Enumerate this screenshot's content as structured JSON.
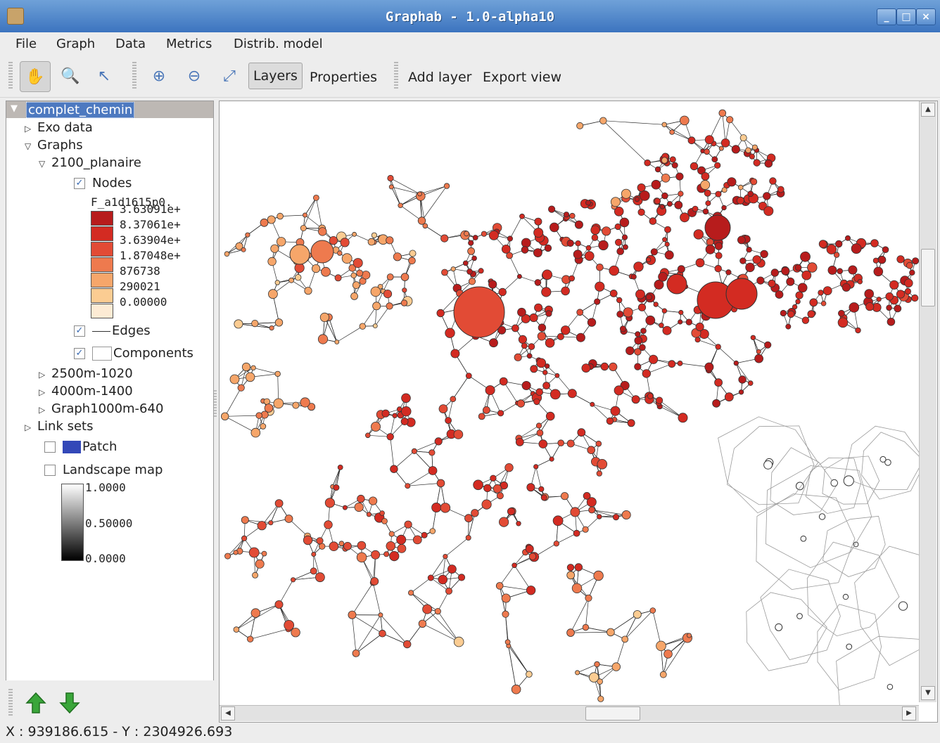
{
  "window": {
    "title": "Graphab - 1.0-alpha10",
    "controls": {
      "minimize": "_",
      "maximize": "□",
      "close": "×"
    }
  },
  "menu": [
    "File",
    "Graph",
    "Data",
    "Metrics",
    "Distrib. model"
  ],
  "toolbar": {
    "tools": [
      {
        "name": "pan-hand-icon",
        "glyph": "✋",
        "active": true
      },
      {
        "name": "zoom-tool-icon",
        "glyph": "🔍",
        "active": false
      },
      {
        "name": "select-pointer-icon",
        "glyph": "↖",
        "active": false
      },
      {
        "name": "zoom-in-icon",
        "glyph": "⊕",
        "active": false
      },
      {
        "name": "zoom-out-icon",
        "glyph": "⊖",
        "active": false
      },
      {
        "name": "zoom-extent-icon",
        "glyph": "⤢",
        "active": false
      }
    ],
    "layers_label": "Layers",
    "properties_label": "Properties",
    "add_layer_label": "Add layer",
    "export_view_label": "Export view"
  },
  "tree": {
    "root": "complet_chemin",
    "exo_data": "Exo data",
    "graphs": "Graphs",
    "graph_open": "2100_planaire",
    "nodes": "Nodes",
    "nodes_checked": true,
    "legend_title": "F_a1d1615p0.",
    "legend": [
      {
        "label": "3.63091e+",
        "color": "#b71c1c"
      },
      {
        "label": "8.37061e+",
        "color": "#d32b22"
      },
      {
        "label": "3.63904e+",
        "color": "#e24b35"
      },
      {
        "label": "1.87048e+",
        "color": "#ee7a4e"
      },
      {
        "label": "876738",
        "color": "#f6a66a"
      },
      {
        "label": "290021",
        "color": "#fbcc92"
      },
      {
        "label": "0.00000",
        "color": "#fdebd4"
      }
    ],
    "edges": "Edges",
    "edges_checked": true,
    "components": "Components",
    "components_checked": true,
    "other_graphs": [
      "2500m-1020",
      "4000m-1400",
      "Graph1000m-640"
    ],
    "link_sets": "Link sets",
    "patch": "Patch",
    "patch_checked": false,
    "patch_color": "#3348b8",
    "landscape_map": "Landscape map",
    "landscape_checked": false,
    "gray_legend": [
      "1.0000",
      "0.50000",
      "0.0000"
    ]
  },
  "map": {
    "node_stroke": "#333333",
    "edge_color": "#2d2d2d"
  },
  "status": {
    "coords": "X : 939186.615 - Y : 2304926.693"
  },
  "colors": {
    "titlebar": "#4a80c8",
    "selection": "#4d79c0",
    "move_up": "#2f9e2f"
  }
}
